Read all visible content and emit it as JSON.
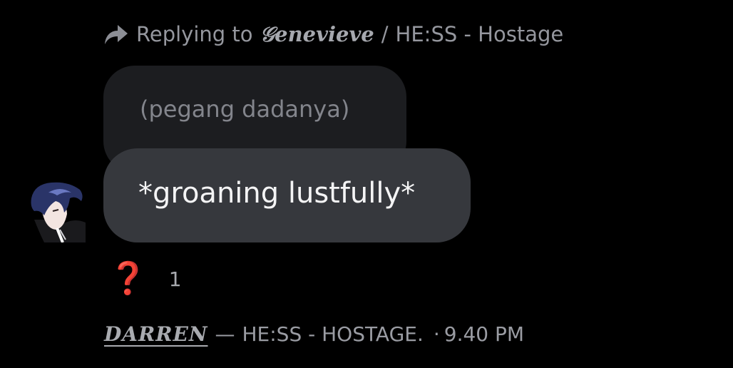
{
  "reply": {
    "prefix": "Replying to",
    "name": "𝒢enevieve",
    "separator": "/",
    "channel": "HE:SS - Hostage"
  },
  "quoted_message": {
    "text": "(pegang dadanya)"
  },
  "message": {
    "text": "*groaning lustfully*"
  },
  "reaction": {
    "glyph": "❓",
    "count": "1"
  },
  "footer": {
    "sender": "DARREN",
    "separator": "—",
    "channel": "HE:SS - HOSTAGE.",
    "dot": "·",
    "time": "9.40 PM"
  },
  "colors": {
    "background": "#000000",
    "bubble_main": "#36383d",
    "bubble_quoted": "#1c1d20",
    "reaction": "#d12b1f"
  },
  "icons": {
    "reply": "reply-arrow-icon",
    "reaction": "question-mark-icon"
  }
}
